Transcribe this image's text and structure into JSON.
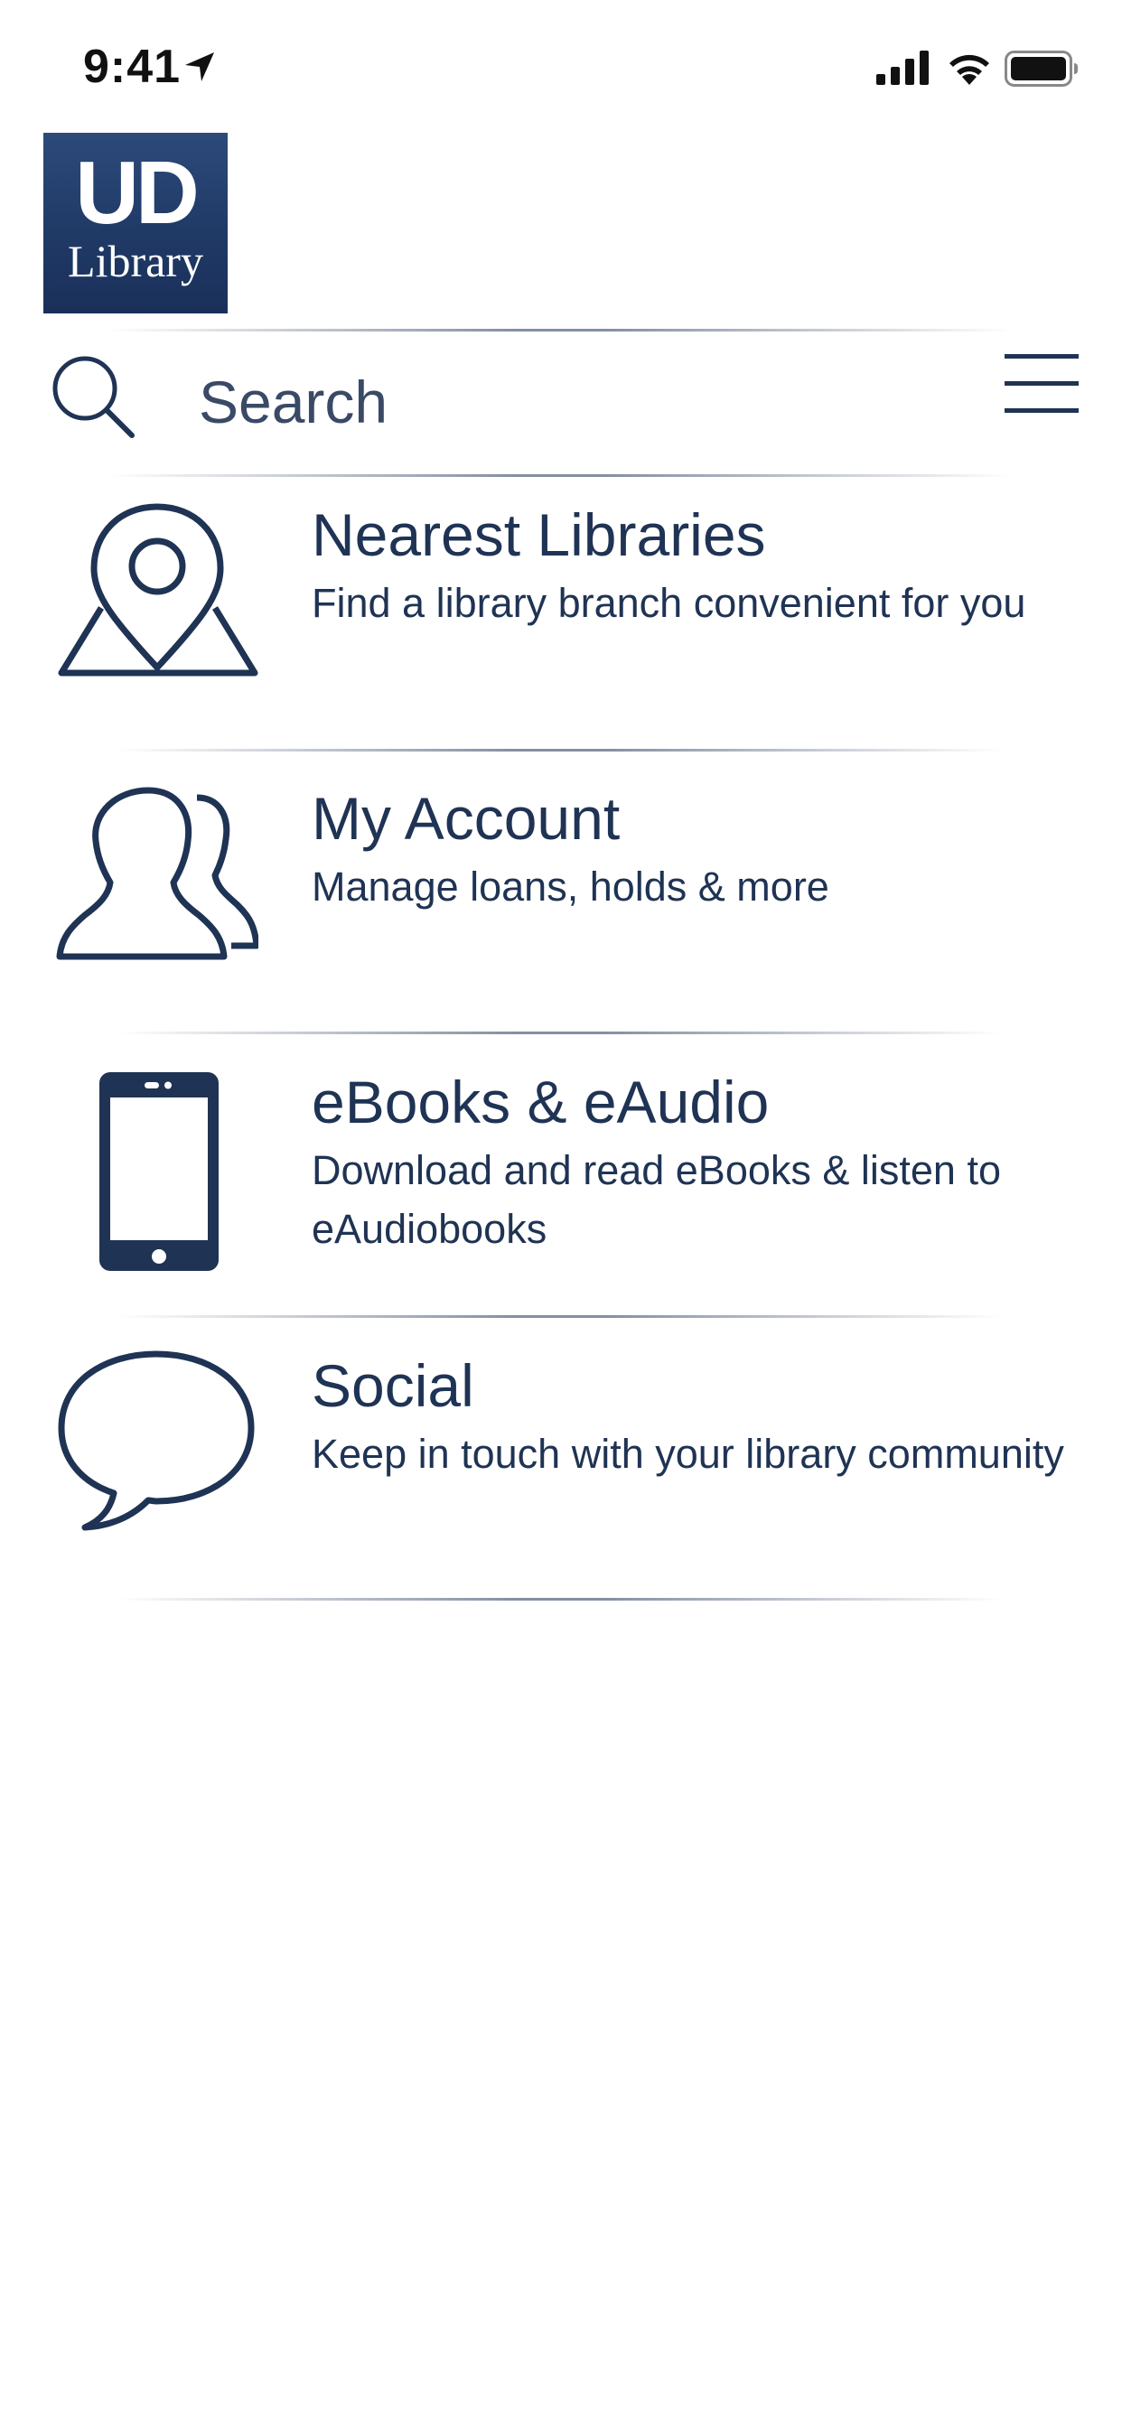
{
  "status_bar": {
    "time": "9:41",
    "icons": [
      "location-arrow-icon",
      "cellular-signal-icon",
      "wifi-icon",
      "battery-icon"
    ]
  },
  "logo": {
    "line1": "UD",
    "line2": "Library"
  },
  "search": {
    "placeholder": "Search",
    "value": ""
  },
  "menu": [
    {
      "title": "Nearest Libraries",
      "subtitle": "Find a library branch convenient for you",
      "icon": "map-pin-icon"
    },
    {
      "title": "My Account",
      "subtitle": "Manage loans, holds & more",
      "icon": "users-icon"
    },
    {
      "title": "eBooks & eAudio",
      "subtitle": "Download and read eBooks & listen to eAudiobooks",
      "icon": "smartphone-icon"
    },
    {
      "title": "Social",
      "subtitle": "Keep in touch with your library community",
      "icon": "speech-bubble-icon"
    }
  ],
  "colors": {
    "primary": "#1f3354",
    "logo_bg": "#203a66",
    "background": "#ffffff"
  }
}
